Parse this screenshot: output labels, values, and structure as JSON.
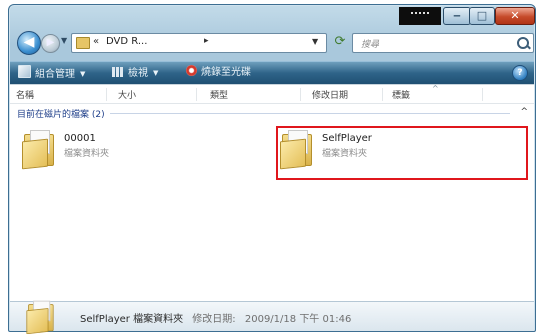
{
  "window": {
    "caption_buttons": {
      "minimize": "‒",
      "maximize": "□",
      "close": "✕"
    }
  },
  "address_bar": {
    "path_prefix": "«",
    "path_text": "DVD R...",
    "path_separator": "▸",
    "search_placeholder": "搜尋"
  },
  "toolbar": {
    "organize_label": "組合管理",
    "views_label": "檢視",
    "burn_label": "燒錄至光碟",
    "dropdown_glyph": "▼",
    "help_glyph": "?"
  },
  "columns": {
    "name": "名稱",
    "size": "大小",
    "type": "類型",
    "date": "修改日期",
    "tags": "標籤",
    "sort_indicator": "^"
  },
  "group": {
    "label": "目前在磁片的檔案 (2)",
    "toggle": "^"
  },
  "items": [
    {
      "name": "00001",
      "type": "檔案資料夾"
    },
    {
      "name": "SelfPlayer",
      "type": "檔案資料夾"
    }
  ],
  "details": {
    "name": "SelfPlayer",
    "type": "檔案資料夾",
    "modified_label": "修改日期:",
    "modified_value": "2009/1/18 下午 01:46"
  },
  "colors": {
    "highlight_border": "#e0161c",
    "toolbar_dark": "#1f4f72",
    "group_label": "#1f3f8a"
  },
  "icons": [
    "back-icon",
    "forward-icon",
    "folder-icon",
    "refresh-icon",
    "search-icon",
    "organize-icon",
    "views-icon",
    "burn-icon",
    "help-icon"
  ]
}
